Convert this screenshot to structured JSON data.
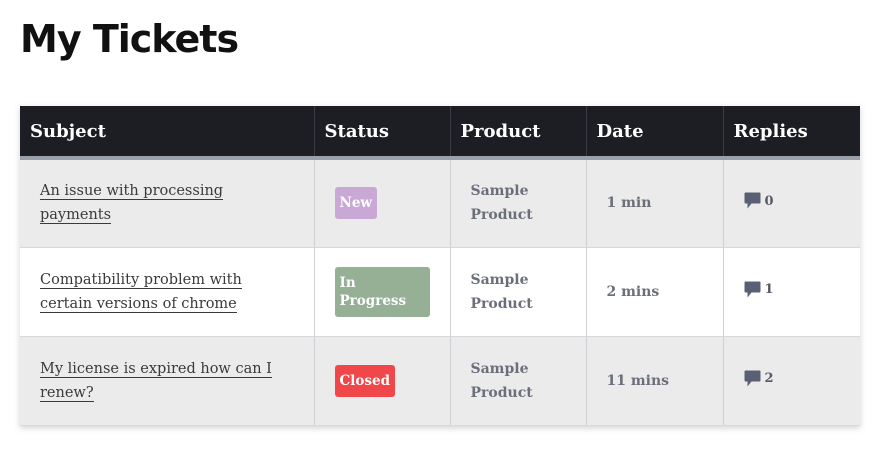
{
  "page": {
    "title": "My Tickets"
  },
  "table": {
    "headers": [
      "Subject",
      "Status",
      "Product",
      "Date",
      "Replies"
    ],
    "rows": [
      {
        "subject": "An issue with processing payments",
        "status": "New",
        "status_color": "#c9a8d6",
        "product_line1": "Sample",
        "product_line2": "Product",
        "date": "1 min",
        "replies": "0",
        "replies_icon": "comment-icon"
      },
      {
        "subject": "Compatibility problem with certain versions of chrome",
        "status": "In Progress",
        "status_color": "#95b095",
        "product_line1": "Sample",
        "product_line2": "Product",
        "date": "2 mins",
        "replies": "1",
        "replies_icon": "comment-icon"
      },
      {
        "subject": "My license is expired how can I renew?",
        "status": "Closed",
        "status_color": "#f0474a",
        "product_line1": "Sample",
        "product_line2": "Product",
        "date": "11 mins",
        "replies": "2",
        "replies_icon": "comment-icon"
      }
    ]
  }
}
